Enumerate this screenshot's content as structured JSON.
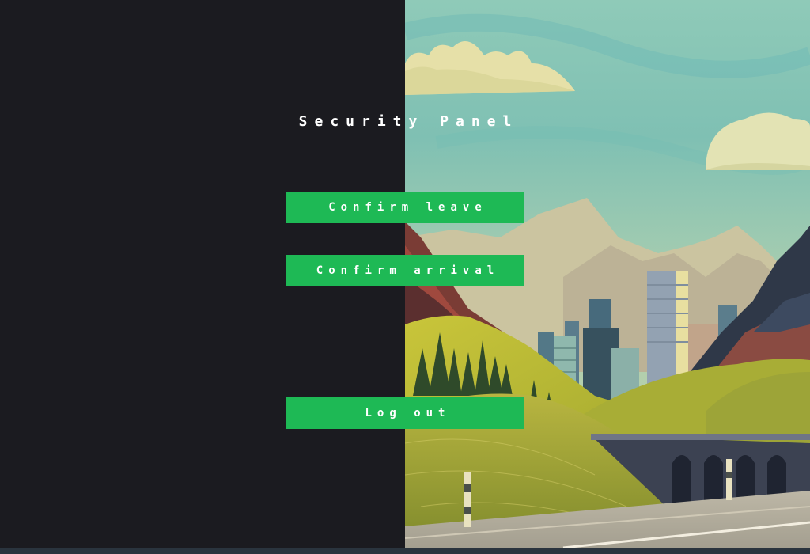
{
  "panel": {
    "title": "Security Panel"
  },
  "actions": {
    "confirm_leave": "Confirm leave",
    "confirm_arrival": "Confirm arrival",
    "log_out": "Log out"
  },
  "colors": {
    "background": "#1b1b20",
    "button": "#1eb955",
    "button_text": "#ffffff",
    "title_text": "#ffffff"
  },
  "illustration": {
    "subject": "mountain-city-landscape"
  }
}
